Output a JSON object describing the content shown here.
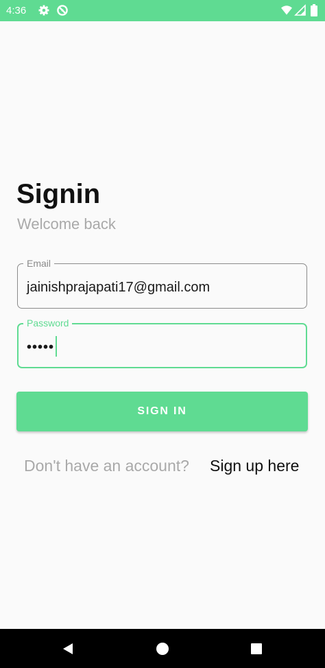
{
  "status_bar": {
    "time": "4:36",
    "background_color": "#5fdb92",
    "left_icons": [
      "gear-icon",
      "data-saver-icon"
    ],
    "right_icons": [
      "wifi-icon",
      "signal-icon",
      "battery-icon"
    ]
  },
  "signin": {
    "title": "Signin",
    "subtitle": "Welcome back",
    "email": {
      "label": "Email",
      "value": "jainishprajapati17@gmail.com"
    },
    "password": {
      "label": "Password",
      "masked_value": "•••••"
    },
    "button_label": "SIGN IN",
    "signup_prompt": "Don't have an account?",
    "signup_link": "Sign up here"
  },
  "colors": {
    "accent": "#5fdb92",
    "title_text": "#111111",
    "muted_text": "#a9a9a9",
    "background": "#fafafa"
  },
  "nav_bar": {
    "buttons": [
      "back-icon",
      "home-icon",
      "recents-icon"
    ]
  }
}
